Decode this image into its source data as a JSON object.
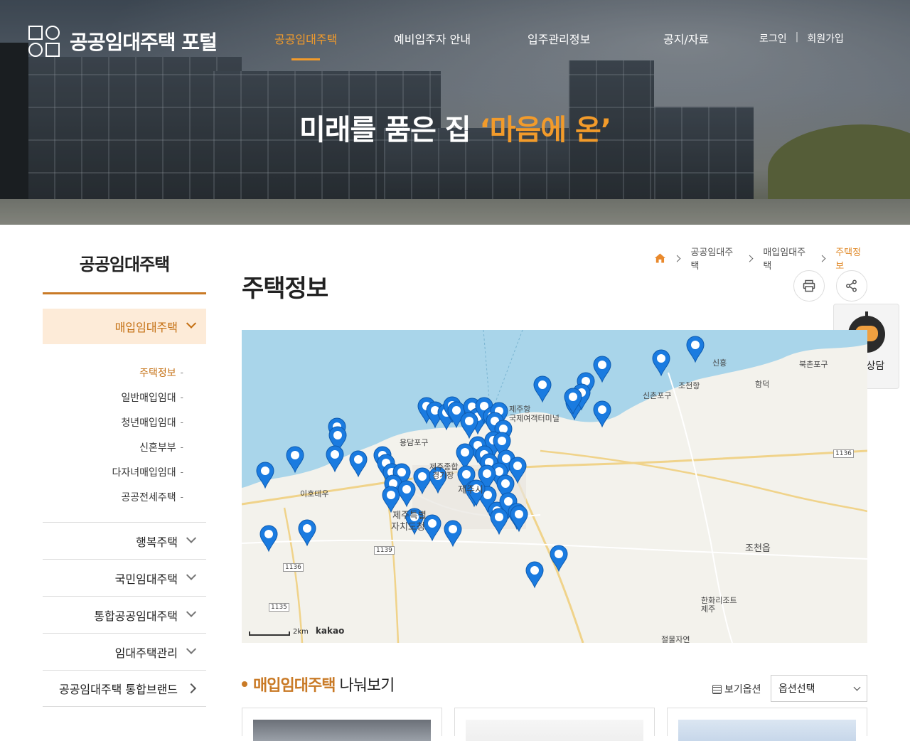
{
  "site": {
    "title": "공공임대주택 포털"
  },
  "gnb": {
    "items": [
      "공공임대주택",
      "예비입주자 안내",
      "입주관리정보",
      "공지/자료"
    ],
    "active_index": 0,
    "login": "로그인",
    "separator": "|",
    "signup": "회원가입"
  },
  "hero": {
    "title_main": "미래를 품은 집 ",
    "title_accent": "‘마음에 온’"
  },
  "lnb": {
    "title": "공공임대주택",
    "active": "매입임대주택",
    "sub_items": [
      "주택정보",
      "일반매입임대",
      "청년매입임대",
      "신혼부부",
      "다자녀매입임대",
      "공공전세주택"
    ],
    "sub_dash": "-",
    "items": [
      "행복주택",
      "국민임대주택",
      "통합공공임대주택",
      "임대주택관리",
      "공공임대주택 통합브랜드"
    ]
  },
  "breadcrumb": [
    "공공임대주택",
    "매입임대주택",
    "주택정보"
  ],
  "page": {
    "title": "주택정보"
  },
  "chatbot": {
    "label": "챗봇상담"
  },
  "map": {
    "labels": [
      "제주항\n국제여객터미널",
      "용담포구",
      "제주종합\n경기장",
      "신촌포구",
      "조천항",
      "신흥",
      "함덕",
      "북촌포구",
      "이호테우",
      "제주특별\n자치도청",
      "조천읍",
      "한화리조트\n제주",
      "절물자연",
      "제주시"
    ],
    "road_numbers": [
      "1136",
      "1139",
      "1136",
      "1135"
    ],
    "scale": "2km",
    "attribution": "kakao"
  },
  "section": {
    "accent": "매입임대주택",
    "rest": " 나눠보기"
  },
  "view_option": {
    "label": "보기옵션",
    "select_value": "옵션선택"
  },
  "colors": {
    "accent": "#c97a26",
    "nav_active": "#f29b2b",
    "marker": "#1a7be0"
  }
}
